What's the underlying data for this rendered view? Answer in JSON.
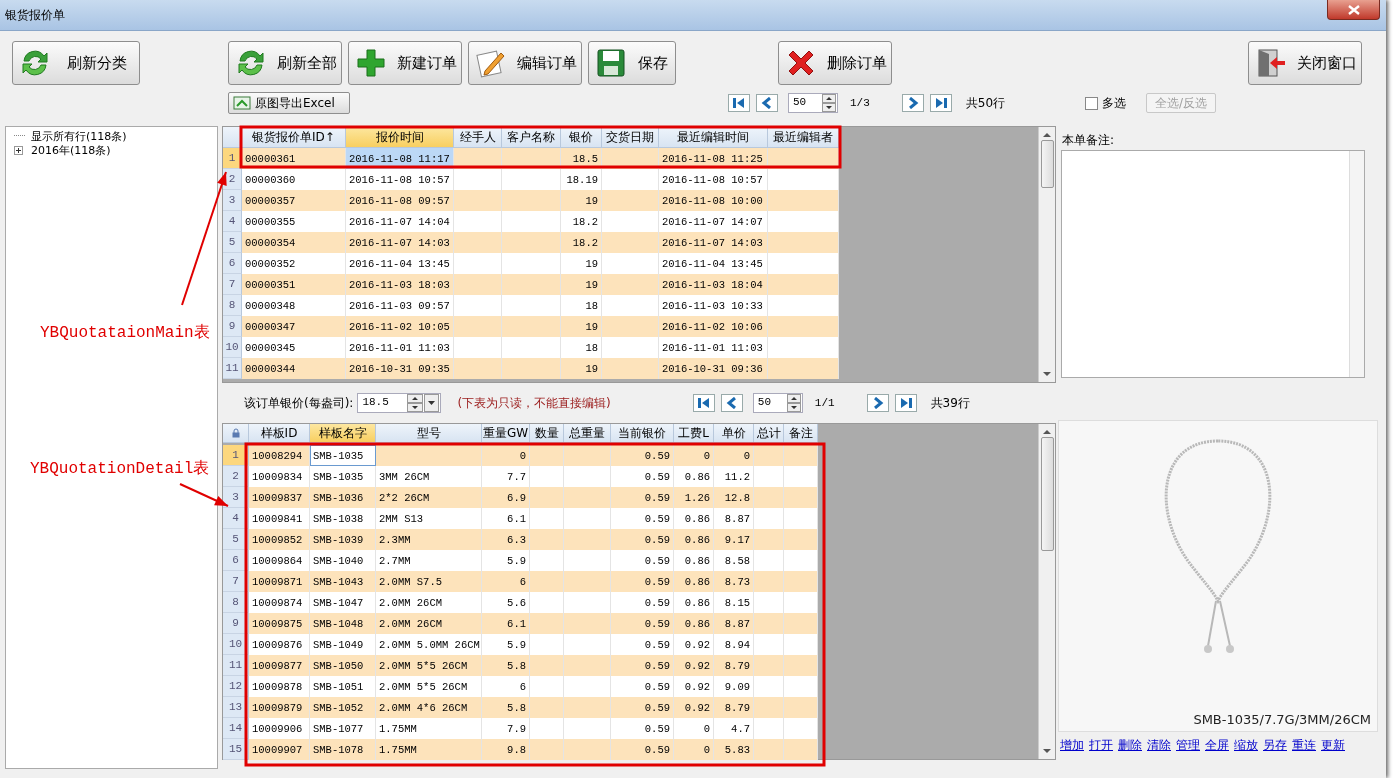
{
  "window": {
    "title": "银货报价单"
  },
  "toolbar": {
    "buttons": [
      {
        "label": "刷新分类",
        "kind": "refresh"
      },
      {
        "label": "刷新全部",
        "kind": "refresh"
      },
      {
        "label": "新建订单",
        "kind": "add"
      },
      {
        "label": "编辑订单",
        "kind": "edit"
      },
      {
        "label": "保存",
        "kind": "save"
      },
      {
        "label": "删除订单",
        "kind": "delete"
      },
      {
        "label": "关闭窗口",
        "kind": "exit"
      }
    ]
  },
  "export_button": {
    "label": "原图导出Excel"
  },
  "top_pager": {
    "page_size": "50",
    "page": "1/3",
    "total": "共50行"
  },
  "multi_select": {
    "label": "多选",
    "checked": false
  },
  "select_all_button": {
    "label": "全选/反选",
    "disabled": true
  },
  "tree": {
    "items": [
      {
        "label": "显示所有行(118条)",
        "kind": "leaf"
      },
      {
        "label": "2016年(118条)",
        "kind": "group",
        "expanded": false
      }
    ]
  },
  "orders_table": {
    "columns": [
      {
        "label": "银货报价单ID",
        "sort_mark": "↑",
        "kind": "text",
        "selected": false
      },
      {
        "label": "报价时间",
        "kind": "text",
        "selected": true
      },
      {
        "label": "经手人",
        "kind": "text",
        "selected": false
      },
      {
        "label": "客户名称",
        "kind": "text",
        "selected": false
      },
      {
        "label": "银价",
        "kind": "number",
        "selected": false
      },
      {
        "label": "交货日期",
        "kind": "text",
        "selected": false
      },
      {
        "label": "最近编辑时间",
        "kind": "text",
        "selected": false
      },
      {
        "label": "最近编辑者",
        "kind": "text",
        "selected": false
      }
    ],
    "rows": [
      {
        "num": "1",
        "selected": true,
        "cells": [
          "00000361",
          "2016-11-08 11:17",
          null,
          null,
          "18.5",
          null,
          "2016-11-08 11:25",
          null
        ]
      },
      {
        "num": "2",
        "selected": false,
        "cells": [
          "00000360",
          "2016-11-08 10:57",
          null,
          null,
          "18.19",
          null,
          "2016-11-08 10:57",
          null
        ]
      },
      {
        "num": "3",
        "selected": false,
        "cells": [
          "00000357",
          "2016-11-08 09:57",
          null,
          null,
          "19",
          null,
          "2016-11-08 10:00",
          null
        ]
      },
      {
        "num": "4",
        "selected": false,
        "cells": [
          "00000355",
          "2016-11-07 14:04",
          null,
          null,
          "18.2",
          null,
          "2016-11-07 14:07",
          null
        ]
      },
      {
        "num": "5",
        "selected": false,
        "cells": [
          "00000354",
          "2016-11-07 14:03",
          null,
          null,
          "18.2",
          null,
          "2016-11-07 14:03",
          null
        ]
      },
      {
        "num": "6",
        "selected": false,
        "cells": [
          "00000352",
          "2016-11-04 13:45",
          null,
          null,
          "19",
          null,
          "2016-11-04 13:45",
          null
        ]
      },
      {
        "num": "7",
        "selected": false,
        "cells": [
          "00000351",
          "2016-11-03 18:03",
          null,
          null,
          "19",
          null,
          "2016-11-03 18:04",
          null
        ]
      },
      {
        "num": "8",
        "selected": false,
        "cells": [
          "00000348",
          "2016-11-03 09:57",
          null,
          null,
          "18",
          null,
          "2016-11-03 10:33",
          null
        ]
      },
      {
        "num": "9",
        "selected": false,
        "cells": [
          "00000347",
          "2016-11-02 10:05",
          null,
          null,
          "19",
          null,
          "2016-11-02 10:06",
          null
        ]
      },
      {
        "num": "10",
        "selected": false,
        "cells": [
          "00000345",
          "2016-11-01 11:03",
          null,
          null,
          "18",
          null,
          "2016-11-01 11:03",
          null
        ]
      },
      {
        "num": "11",
        "selected": false,
        "cells": [
          "00000344",
          "2016-10-31 09:35",
          null,
          null,
          "19",
          null,
          "2016-10-31 09:36",
          null
        ]
      }
    ]
  },
  "notes": {
    "label": "本单备注:"
  },
  "silver_price": {
    "label": "该订单银价(每盎司):",
    "value": "18.5"
  },
  "readonly_note": "(下表为只读，不能直接编辑)",
  "detail_pager": {
    "page_size": "50",
    "page": "1/1",
    "total": "共39行"
  },
  "detail_table": {
    "columns": [
      {
        "label": "样板ID",
        "kind": "text",
        "selected": false
      },
      {
        "label": "样板名字",
        "kind": "text",
        "selected": true
      },
      {
        "label": "型号",
        "kind": "text",
        "selected": false
      },
      {
        "label": "重量GW",
        "kind": "number",
        "selected": false
      },
      {
        "label": "数量",
        "kind": "number",
        "selected": false
      },
      {
        "label": "总重量",
        "kind": "number",
        "selected": false
      },
      {
        "label": "当前银价",
        "kind": "number",
        "selected": false
      },
      {
        "label": "工费L",
        "kind": "number",
        "selected": false
      },
      {
        "label": "单价",
        "kind": "number",
        "selected": false
      },
      {
        "label": "总计",
        "kind": "number",
        "selected": false
      },
      {
        "label": "备注",
        "kind": "text",
        "selected": false
      }
    ],
    "rows": [
      {
        "num": "1",
        "selected": true,
        "cells": [
          "10008294",
          "SMB-1035",
          null,
          "0",
          null,
          null,
          "0.59",
          "0",
          "0",
          null,
          null
        ]
      },
      {
        "num": "2",
        "selected": false,
        "cells": [
          "10009834",
          "SMB-1035",
          "3MM 26CM",
          "7.7",
          null,
          null,
          "0.59",
          "0.86",
          "11.2",
          null,
          null
        ]
      },
      {
        "num": "3",
        "selected": false,
        "cells": [
          "10009837",
          "SMB-1036",
          "2*2 26CM",
          "6.9",
          null,
          null,
          "0.59",
          "1.26",
          "12.8",
          null,
          null
        ]
      },
      {
        "num": "4",
        "selected": false,
        "cells": [
          "10009841",
          "SMB-1038",
          "2MM S13",
          "6.1",
          null,
          null,
          "0.59",
          "0.86",
          "8.87",
          null,
          null
        ]
      },
      {
        "num": "5",
        "selected": false,
        "cells": [
          "10009852",
          "SMB-1039",
          "2.3MM",
          "6.3",
          null,
          null,
          "0.59",
          "0.86",
          "9.17",
          null,
          null
        ]
      },
      {
        "num": "6",
        "selected": false,
        "cells": [
          "10009864",
          "SMB-1040",
          "2.7MM",
          "5.9",
          null,
          null,
          "0.59",
          "0.86",
          "8.58",
          null,
          null
        ]
      },
      {
        "num": "7",
        "selected": false,
        "cells": [
          "10009871",
          "SMB-1043",
          "2.0MM S7.5",
          "6",
          null,
          null,
          "0.59",
          "0.86",
          "8.73",
          null,
          null
        ]
      },
      {
        "num": "8",
        "selected": false,
        "cells": [
          "10009874",
          "SMB-1047",
          "2.0MM 26CM",
          "5.6",
          null,
          null,
          "0.59",
          "0.86",
          "8.15",
          null,
          null
        ]
      },
      {
        "num": "9",
        "selected": false,
        "cells": [
          "10009875",
          "SMB-1048",
          "2.0MM 26CM",
          "6.1",
          null,
          null,
          "0.59",
          "0.86",
          "8.87",
          null,
          null
        ]
      },
      {
        "num": "10",
        "selected": false,
        "cells": [
          "10009876",
          "SMB-1049",
          "2.0MM 5.0MM 26CM",
          "5.9",
          null,
          null,
          "0.59",
          "0.92",
          "8.94",
          null,
          null
        ]
      },
      {
        "num": "11",
        "selected": false,
        "cells": [
          "10009877",
          "SMB-1050",
          "2.0MM 5*5 26CM",
          "5.8",
          null,
          null,
          "0.59",
          "0.92",
          "8.79",
          null,
          null
        ]
      },
      {
        "num": "12",
        "selected": false,
        "cells": [
          "10009878",
          "SMB-1051",
          "2.0MM 5*5 26CM",
          "6",
          null,
          null,
          "0.59",
          "0.92",
          "9.09",
          null,
          null
        ]
      },
      {
        "num": "13",
        "selected": false,
        "cells": [
          "10009879",
          "SMB-1052",
          "2.0MM 4*6 26CM",
          "5.8",
          null,
          null,
          "0.59",
          "0.92",
          "8.79",
          null,
          null
        ]
      },
      {
        "num": "14",
        "selected": false,
        "cells": [
          "10009906",
          "SMB-1077",
          "1.75MM",
          "7.9",
          null,
          null,
          "0.59",
          "0",
          "4.7",
          null,
          null
        ]
      },
      {
        "num": "15",
        "selected": false,
        "cells": [
          "10009907",
          "SMB-1078",
          "1.75MM",
          "9.8",
          null,
          null,
          "0.59",
          "0",
          "5.83",
          null,
          null
        ]
      }
    ]
  },
  "image_panel": {
    "caption": "SMB-1035/7.7G/3MM/26CM",
    "links": [
      "增加",
      "打开",
      "删除",
      "清除",
      "管理",
      "全屏",
      "缩放",
      "另存",
      "重连",
      "更新"
    ]
  },
  "annotations": [
    {
      "label": "YBQuotataionMain表"
    },
    {
      "label": "YBQuotationDetail表"
    }
  ]
}
